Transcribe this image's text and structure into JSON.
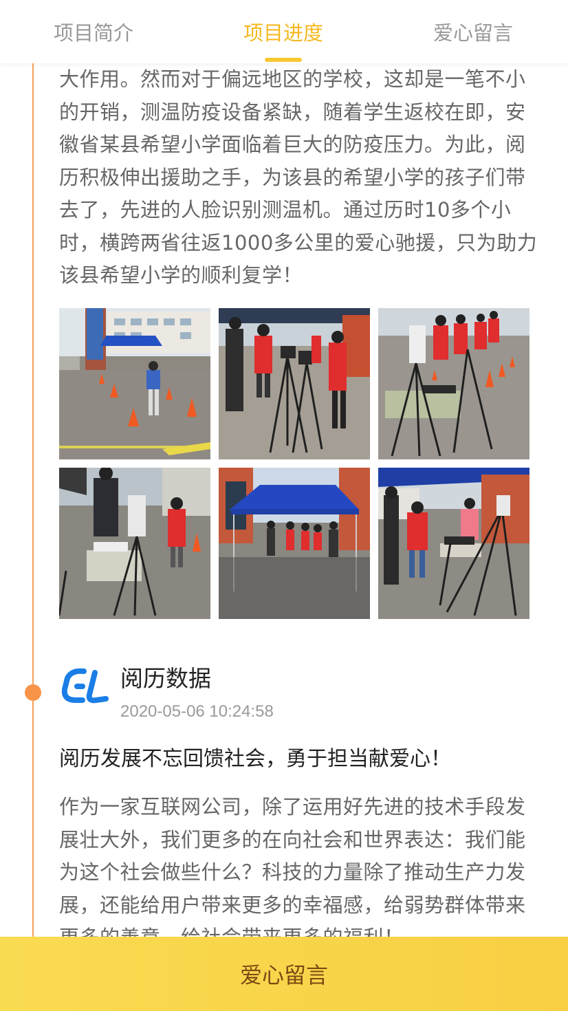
{
  "tabs": [
    {
      "label": "项目简介",
      "active": false
    },
    {
      "label": "项目进度",
      "active": true
    },
    {
      "label": "爱心留言",
      "active": false
    }
  ],
  "accent_color": "#f6b820",
  "timeline_color": "#f7a05a",
  "update_top": {
    "paragraph": "大作用。然而对于偏远地区的学校，这却是一笔不小的开销，测温防疫设备紧缺，随着学生返校在即，安徽省某县希望小学面临着巨大的防疫压力。为此，阅历积极伸出援助之手，为该县的希望小学的孩子们带去了，先进的人脸识别测温机。通过历时10多个小时，横跨两省往返1000多公里的爱心驰援，只为助力该县希望小学的顺利复学！"
  },
  "photos": [
    {
      "desc": "school entrance with blue tent and traffic cones"
    },
    {
      "desc": "students in red jackets at thermal camera tripod"
    },
    {
      "desc": "thermal scanner on tripod with students queueing"
    },
    {
      "desc": "temperature screening station with monitor"
    },
    {
      "desc": "blue canopy tent in schoolyard"
    },
    {
      "desc": "students passing scanning machine under tent"
    }
  ],
  "update_next": {
    "author_logo_icon": "yueli-logo-icon",
    "author_name": "阅历数据",
    "date": "2020-05-06 10:24:58",
    "title": "阅历发展不忘回馈社会，勇于担当献爱心！",
    "paragraph": "作为一家互联网公司，除了运用好先进的技术手段发展壮大外，我们更多的在向社会和世界表达：我们能为这个社会做些什么？科技的力量除了推动生产力发展，还能给用户带来更多的幸福感，给弱势群体带来更多的善意，给社会带来更多的福利！"
  },
  "cta": {
    "label": "爱心留言"
  }
}
